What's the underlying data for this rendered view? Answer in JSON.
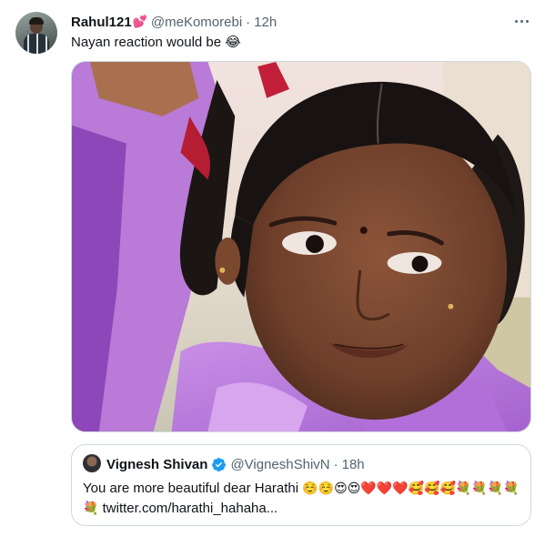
{
  "tweet": {
    "display_name": "Rahul121",
    "name_emoji": "💕",
    "handle": "@meKomorebi",
    "separator": "·",
    "time": "12h",
    "text": "Nayan reaction would be",
    "text_emoji": "😂",
    "more_icon": "more-horizontal-icon",
    "media": {
      "alt": ""
    }
  },
  "quote": {
    "display_name": "Vignesh Shivan",
    "verified_icon": "verified-badge-icon",
    "handle": "@VigneshShivN",
    "separator": "·",
    "time": "18h",
    "text": "You are more beautiful dear Harathi",
    "emojis": "☺️☺️😍😍❤️❤️❤️🥰🥰🥰💐💐💐💐💐",
    "link": "twitter.com/harathi_hahaha..."
  },
  "colors": {
    "text": "#0f1419",
    "muted": "#536471",
    "border": "#cfd9de",
    "verified": "#1d9bf0",
    "heart": "#e8255f"
  }
}
